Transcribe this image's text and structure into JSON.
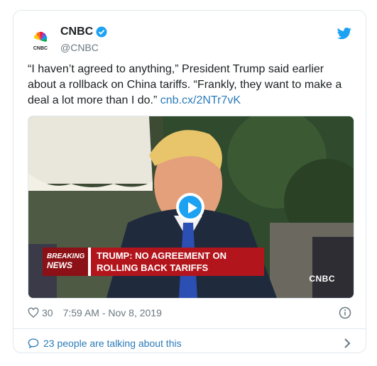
{
  "tweet": {
    "display_name": "CNBC",
    "handle": "@CNBC",
    "text_main": "“I haven’t agreed to anything,” President Trump said earlier about a rollback on China tariffs. “Frankly, they want to make a deal a lot more than I do.” ",
    "link_text": "cnb.cx/2NTr7vK",
    "likes": "30",
    "timestamp": "7:59 AM - Nov 8, 2019",
    "conversation_text": "23 people are talking about this"
  },
  "media": {
    "breaking_line1": "BREAKING",
    "breaking_line2": "NEWS",
    "headline_line1": "TRUMP: NO AGREEMENT ON",
    "headline_line2": "ROLLING BACK TARIFFS",
    "bug": "CNBC"
  },
  "icons": {
    "avatar": "cnbc-peacock-logo",
    "verified": "verified-badge-icon",
    "bird": "twitter-bird-icon",
    "play": "play-icon",
    "like": "heart-icon",
    "info": "info-icon",
    "conversation": "speech-bubble-icon",
    "chevron": "chevron-right-icon"
  },
  "colors": {
    "accent": "#1da1f2",
    "link": "#2b7bb9",
    "muted": "#697882",
    "breaking_red": "#b3151c"
  }
}
